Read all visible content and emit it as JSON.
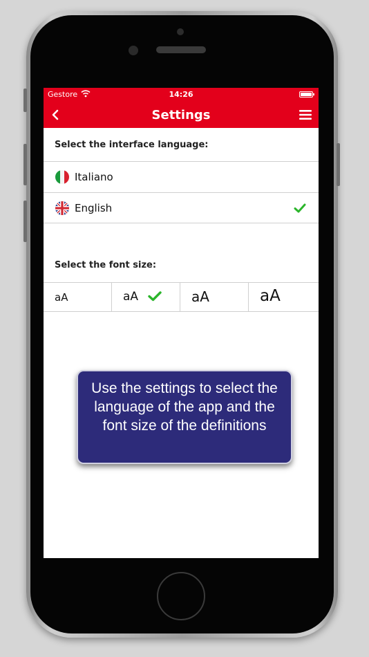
{
  "status_bar": {
    "carrier": "Gestore",
    "time": "14:26"
  },
  "nav": {
    "title": "Settings",
    "back_icon": "chevron-left-icon",
    "menu_icon": "hamburger-menu-icon"
  },
  "language_section": {
    "label": "Select the interface language:",
    "options": [
      {
        "label": "Italiano",
        "flag": "italy-flag-icon",
        "selected": false
      },
      {
        "label": "English",
        "flag": "uk-flag-icon",
        "selected": true
      }
    ]
  },
  "font_section": {
    "label": "Select the font size:",
    "options": [
      {
        "label": "aA",
        "selected": false
      },
      {
        "label": "aA",
        "selected": true
      },
      {
        "label": "aA",
        "selected": false
      },
      {
        "label": "aA",
        "selected": false
      }
    ]
  },
  "tooltip": {
    "text": "Use the settings to select the language of the app and the font size of the definitions"
  },
  "colors": {
    "header_red": "#e3001b",
    "check_green": "#2bb52b",
    "tooltip_bg": "#2d2b7a"
  }
}
